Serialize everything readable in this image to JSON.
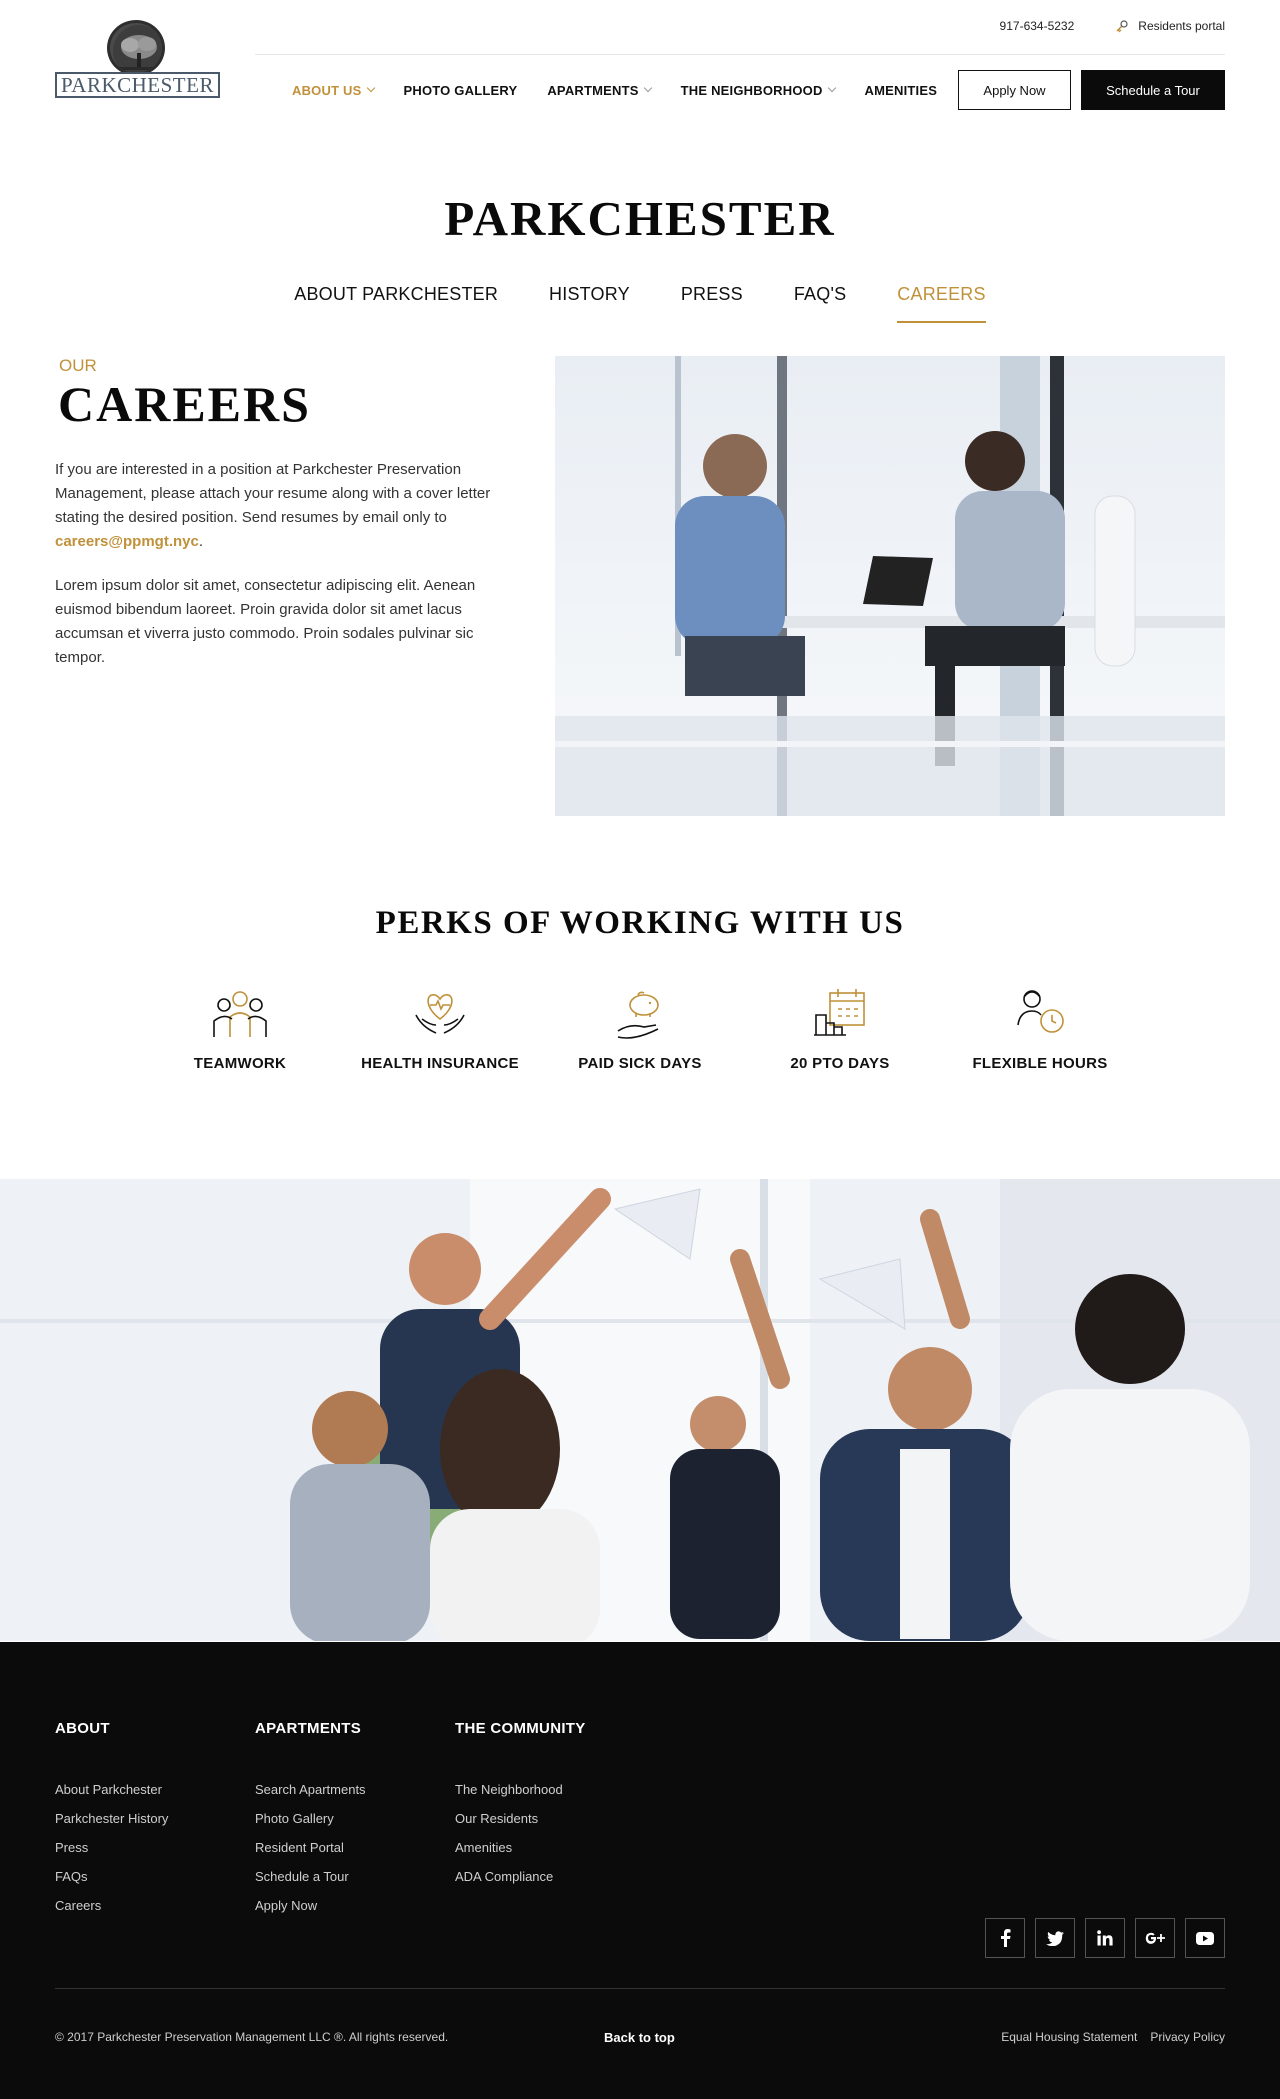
{
  "header": {
    "logo_text": "PARKCHESTER",
    "phone": "917-634-5232",
    "residents_portal": "Residents portal",
    "nav": [
      {
        "label": "ABOUT US",
        "active": true,
        "has_dropdown": true
      },
      {
        "label": "PHOTO GALLERY",
        "active": false,
        "has_dropdown": false
      },
      {
        "label": "APARTMENTS",
        "active": false,
        "has_dropdown": true
      },
      {
        "label": "THE NEIGHBORHOOD",
        "active": false,
        "has_dropdown": true
      },
      {
        "label": "AMENITIES",
        "active": false,
        "has_dropdown": false
      }
    ],
    "apply_now": "Apply Now",
    "schedule_tour": "Schedule a Tour"
  },
  "page": {
    "title": "PARKCHESTER",
    "subnav": [
      {
        "label": "ABOUT PARKCHESTER",
        "active": false
      },
      {
        "label": "HISTORY",
        "active": false
      },
      {
        "label": "PRESS",
        "active": false
      },
      {
        "label": "FAQ'S",
        "active": false
      },
      {
        "label": "CAREERS",
        "active": true
      }
    ]
  },
  "careers": {
    "eyebrow": "OUR",
    "title": "CAREERS",
    "para1": "If you are interested in a position at Parkchester Preservation Management, please attach your resume along with a cover letter stating the desired position. Send resumes by email only to",
    "email": "careers@ppmgt.nyc",
    "para1_end": ".",
    "para2": "Lorem ipsum dolor sit amet, consectetur adipiscing elit. Aenean euismod bibendum laoreet. Proin gravida dolor sit amet lacus accumsan et viverra justo commodo. Proin sodales pulvinar sic tempor."
  },
  "perks": {
    "title": "PERKS OF WORKING WITH US",
    "items": [
      {
        "label": "TEAMWORK",
        "icon": "teamwork-icon"
      },
      {
        "label": "HEALTH INSURANCE",
        "icon": "health-heart-hands-icon"
      },
      {
        "label": "PAID SICK DAYS",
        "icon": "piggy-bank-hand-icon"
      },
      {
        "label": "20 PTO DAYS",
        "icon": "calendar-city-icon"
      },
      {
        "label": "FLEXIBLE HOURS",
        "icon": "person-clock-icon"
      }
    ]
  },
  "footer": {
    "columns": [
      {
        "heading": "ABOUT",
        "links": [
          "About Parkchester",
          "Parkchester History",
          "Press",
          "FAQs",
          "Careers"
        ]
      },
      {
        "heading": "APARTMENTS",
        "links": [
          "Search Apartments",
          "Photo Gallery",
          "Resident Portal",
          "Schedule a Tour",
          "Apply Now"
        ]
      },
      {
        "heading": "THE COMMUNITY",
        "links": [
          "The Neighborhood",
          "Our Residents",
          "Amenities",
          "ADA Compliance"
        ]
      }
    ],
    "social": [
      "facebook-icon",
      "twitter-icon",
      "linkedin-icon",
      "google-plus-icon",
      "youtube-icon"
    ],
    "copyright": "© 2017 Parkchester Preservation Management LLC ®. All rights reserved.",
    "back_to_top": "Back to top",
    "equal_housing": "Equal Housing Statement",
    "privacy": "Privacy Policy"
  },
  "colors": {
    "accent": "#c0913a",
    "dark": "#0b0b0b",
    "text": "#333333"
  }
}
